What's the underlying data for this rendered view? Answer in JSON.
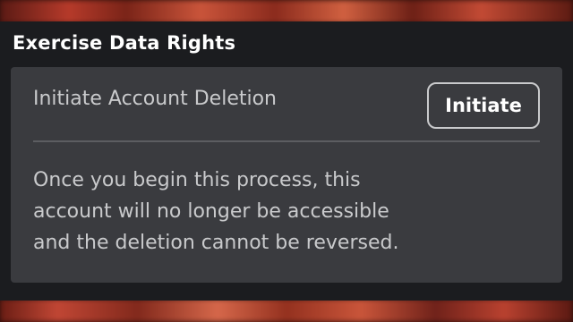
{
  "section": {
    "title": "Exercise Data Rights"
  },
  "deletion": {
    "label": "Initiate Account Deletion",
    "button_label": "Initiate",
    "description_lines": [
      "Once you begin this process, this",
      "account will no longer be accessible",
      "and the deletion cannot be reversed."
    ]
  },
  "colors": {
    "panel_background": "#1b1c1f",
    "card_background": "#3a3b3f",
    "text_primary": "#ffffff",
    "text_secondary": "#c9cacc"
  }
}
